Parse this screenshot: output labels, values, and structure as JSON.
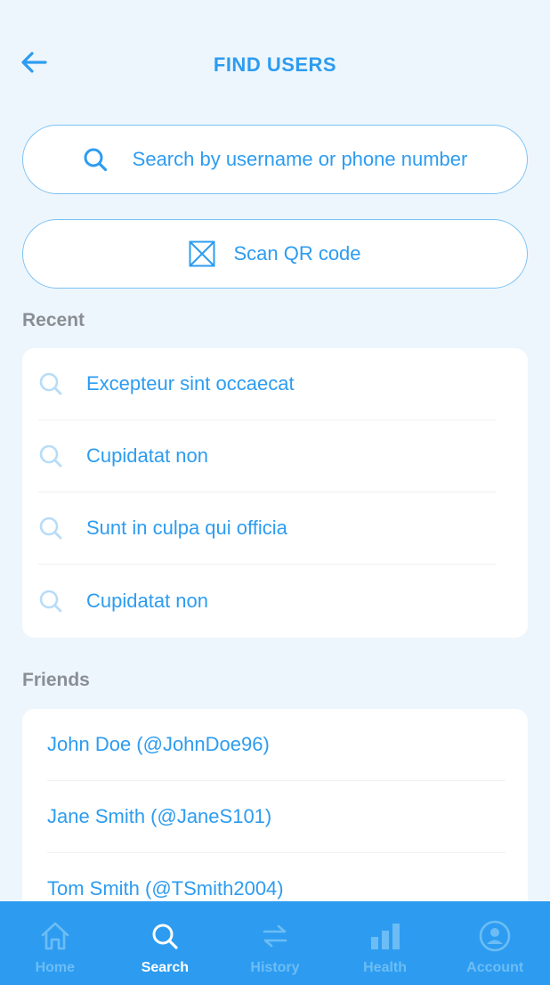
{
  "header": {
    "title": "FIND USERS",
    "back_icon": "arrow-left-icon"
  },
  "search": {
    "placeholder": "Search by username or phone number",
    "icon": "search-icon"
  },
  "scan": {
    "label": "Scan QR code",
    "icon": "qr-code-icon"
  },
  "recent": {
    "title": "Recent",
    "items": [
      {
        "label": "Excepteur sint occaecat"
      },
      {
        "label": "Cupidatat non"
      },
      {
        "label": "Sunt in culpa qui officia"
      },
      {
        "label": "Cupidatat non"
      }
    ]
  },
  "friends": {
    "title": "Friends",
    "items": [
      {
        "label": "John Doe (@JohnDoe96)"
      },
      {
        "label": "Jane Smith (@JaneS101)"
      },
      {
        "label": "Tom Smith (@TSmith2004)"
      }
    ]
  },
  "tabbar": {
    "active": "Search",
    "tabs": [
      {
        "label": "Home",
        "icon": "home-icon"
      },
      {
        "label": "Search",
        "icon": "search-icon"
      },
      {
        "label": "History",
        "icon": "transfer-arrows-icon"
      },
      {
        "label": "Health",
        "icon": "bar-chart-icon"
      },
      {
        "label": "Account",
        "icon": "user-circle-icon"
      }
    ]
  },
  "colors": {
    "accent": "#2d9cf0",
    "background": "#eef6fd",
    "muted": "#8a8f94",
    "tab_inactive": "#6cbdf5"
  }
}
